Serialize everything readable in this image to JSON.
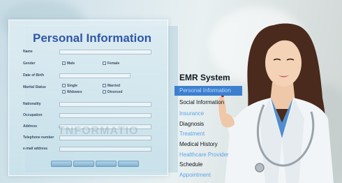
{
  "form": {
    "title": "Personal Information",
    "fields": [
      "Name",
      "Gender",
      "Date of Birth",
      "Marital Status",
      "Nationality",
      "Occupation",
      "Address",
      "Telephone number",
      "e-mail address"
    ],
    "gender_options": [
      "Male",
      "Female"
    ],
    "marital_options": [
      "Single",
      "Married",
      "Widowes",
      "Divorced"
    ],
    "blurred_text": "TNFORMATIO",
    "buttons": [
      "",
      "",
      "",
      ""
    ]
  },
  "emr": {
    "title": "EMR System",
    "items": [
      "Personal Information",
      "Social Information",
      "Insurance",
      "Diagnosis",
      "Treatment",
      "Medical History",
      "Healthcare Provider",
      "Schedule",
      "Appointment"
    ]
  },
  "colors": {
    "title_blue": "#2f56a8",
    "menu_highlight": "#3d7fcf",
    "menu_light": "#5aa4e8",
    "coat": "#f4f6f8",
    "scrubs": "#4f8ed0",
    "hair": "#4a2a1c"
  }
}
